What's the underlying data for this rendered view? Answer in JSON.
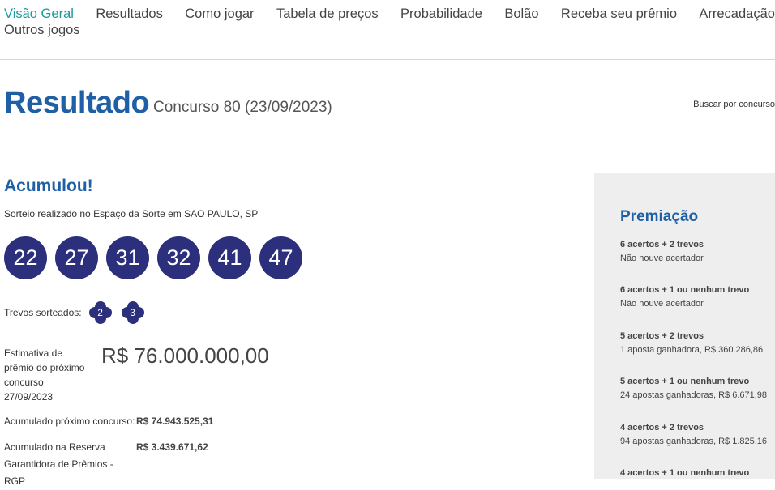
{
  "nav": {
    "items": [
      "Visão Geral",
      "Resultados",
      "Como jogar",
      "Tabela de preços",
      "Probabilidade",
      "Bolão",
      "Receba seu prêmio",
      "Arrecadação"
    ],
    "second_row": "Outros jogos",
    "active_color": "#1a9a9a"
  },
  "header": {
    "title": "Resultado",
    "concurso": "Concurso 80 (23/09/2023)",
    "buscar": "Buscar por concurso"
  },
  "result": {
    "status": "Acumulou!",
    "sorteio": "Sorteio realizado no Espaço da Sorte em SAO PAULO, SP",
    "numbers": [
      "22",
      "27",
      "31",
      "32",
      "41",
      "47"
    ],
    "trevos_label": "Trevos sorteados:",
    "trevos": [
      "2",
      "3"
    ],
    "estimativa_label": "Estimativa de prêmio do próximo concurso 27/09/2023",
    "estimativa_valor": "R$ 76.000.000,00",
    "acumulado_label": "Acumulado próximo concurso:",
    "acumulado_valor": "R$ 74.943.525,31",
    "reserva_label": "Acumulado na Reserva Garantidora de Prêmios - RGP",
    "reserva_valor": "R$ 3.439.671,62"
  },
  "premiacao": {
    "title": "Premiação",
    "tiers": [
      {
        "title": "6 acertos + 2 trevos",
        "result": "Não houve acertador"
      },
      {
        "title": "6 acertos + 1 ou nenhum trevo",
        "result": "Não houve acertador"
      },
      {
        "title": "5 acertos + 2 trevos",
        "result": "1 aposta ganhadora, R$ 360.286,86"
      },
      {
        "title": "5 acertos + 1 ou nenhum trevo",
        "result": "24 apostas ganhadoras, R$ 6.671,98"
      },
      {
        "title": "4 acertos + 2 trevos",
        "result": "94 apostas ganhadoras, R$ 1.825,16"
      },
      {
        "title": "4 acertos + 1 ou nenhum trevo",
        "result": ""
      }
    ]
  },
  "colors": {
    "brand_blue": "#1f5fa6",
    "ball_navy": "#2c2f7c",
    "sidebar_bg": "#eeeeee"
  }
}
